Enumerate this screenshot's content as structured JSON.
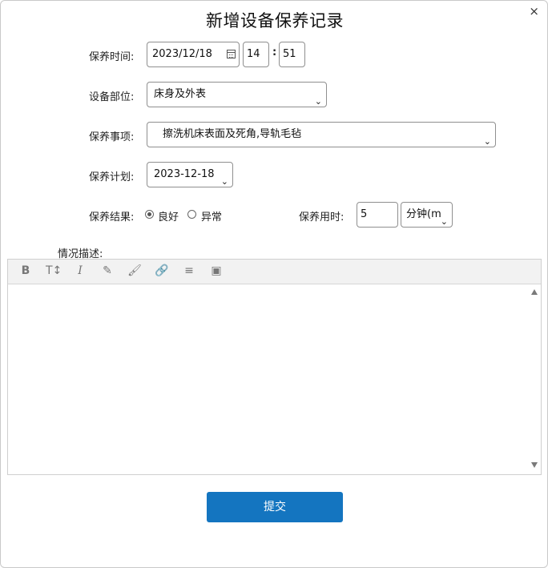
{
  "dialog": {
    "title": "新增设备保养记录",
    "close": "×"
  },
  "form": {
    "time_label": "保养时间:",
    "date_value": "2023/12/18",
    "hour_value": "14",
    "minute_value": "51",
    "part_label": "设备部位:",
    "part_value": "床身及外表",
    "item_label": "保养事项:",
    "item_value": "擦洗机床表面及死角,导轨毛毡",
    "plan_label": "保养计划:",
    "plan_value": "2023-12-18",
    "result_label": "保养结果:",
    "result_options": [
      {
        "label": "良好",
        "checked": true
      },
      {
        "label": "异常",
        "checked": false
      }
    ],
    "duration_label": "保养用时:",
    "duration_value": "5",
    "duration_unit": "分钟(m",
    "desc_label": "情况描述:"
  },
  "toolbar": [
    "bold-icon",
    "text-size-icon",
    "italic-icon",
    "highlighter-icon",
    "brush-icon",
    "link-icon",
    "align-icon",
    "image-icon"
  ],
  "submit_label": "提交",
  "colors": {
    "submit": "#1475c0"
  }
}
